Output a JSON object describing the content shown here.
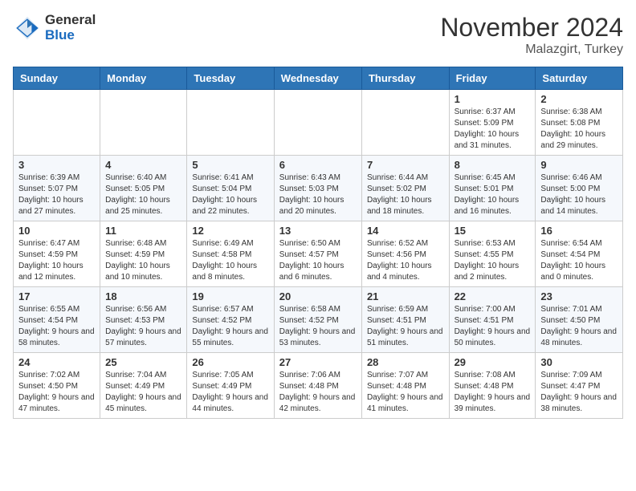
{
  "header": {
    "logo_general": "General",
    "logo_blue": "Blue",
    "month_title": "November 2024",
    "location": "Malazgirt, Turkey"
  },
  "days_of_week": [
    "Sunday",
    "Monday",
    "Tuesday",
    "Wednesday",
    "Thursday",
    "Friday",
    "Saturday"
  ],
  "weeks": [
    [
      {
        "day": "",
        "info": ""
      },
      {
        "day": "",
        "info": ""
      },
      {
        "day": "",
        "info": ""
      },
      {
        "day": "",
        "info": ""
      },
      {
        "day": "",
        "info": ""
      },
      {
        "day": "1",
        "info": "Sunrise: 6:37 AM\nSunset: 5:09 PM\nDaylight: 10 hours and 31 minutes."
      },
      {
        "day": "2",
        "info": "Sunrise: 6:38 AM\nSunset: 5:08 PM\nDaylight: 10 hours and 29 minutes."
      }
    ],
    [
      {
        "day": "3",
        "info": "Sunrise: 6:39 AM\nSunset: 5:07 PM\nDaylight: 10 hours and 27 minutes."
      },
      {
        "day": "4",
        "info": "Sunrise: 6:40 AM\nSunset: 5:05 PM\nDaylight: 10 hours and 25 minutes."
      },
      {
        "day": "5",
        "info": "Sunrise: 6:41 AM\nSunset: 5:04 PM\nDaylight: 10 hours and 22 minutes."
      },
      {
        "day": "6",
        "info": "Sunrise: 6:43 AM\nSunset: 5:03 PM\nDaylight: 10 hours and 20 minutes."
      },
      {
        "day": "7",
        "info": "Sunrise: 6:44 AM\nSunset: 5:02 PM\nDaylight: 10 hours and 18 minutes."
      },
      {
        "day": "8",
        "info": "Sunrise: 6:45 AM\nSunset: 5:01 PM\nDaylight: 10 hours and 16 minutes."
      },
      {
        "day": "9",
        "info": "Sunrise: 6:46 AM\nSunset: 5:00 PM\nDaylight: 10 hours and 14 minutes."
      }
    ],
    [
      {
        "day": "10",
        "info": "Sunrise: 6:47 AM\nSunset: 4:59 PM\nDaylight: 10 hours and 12 minutes."
      },
      {
        "day": "11",
        "info": "Sunrise: 6:48 AM\nSunset: 4:59 PM\nDaylight: 10 hours and 10 minutes."
      },
      {
        "day": "12",
        "info": "Sunrise: 6:49 AM\nSunset: 4:58 PM\nDaylight: 10 hours and 8 minutes."
      },
      {
        "day": "13",
        "info": "Sunrise: 6:50 AM\nSunset: 4:57 PM\nDaylight: 10 hours and 6 minutes."
      },
      {
        "day": "14",
        "info": "Sunrise: 6:52 AM\nSunset: 4:56 PM\nDaylight: 10 hours and 4 minutes."
      },
      {
        "day": "15",
        "info": "Sunrise: 6:53 AM\nSunset: 4:55 PM\nDaylight: 10 hours and 2 minutes."
      },
      {
        "day": "16",
        "info": "Sunrise: 6:54 AM\nSunset: 4:54 PM\nDaylight: 10 hours and 0 minutes."
      }
    ],
    [
      {
        "day": "17",
        "info": "Sunrise: 6:55 AM\nSunset: 4:54 PM\nDaylight: 9 hours and 58 minutes."
      },
      {
        "day": "18",
        "info": "Sunrise: 6:56 AM\nSunset: 4:53 PM\nDaylight: 9 hours and 57 minutes."
      },
      {
        "day": "19",
        "info": "Sunrise: 6:57 AM\nSunset: 4:52 PM\nDaylight: 9 hours and 55 minutes."
      },
      {
        "day": "20",
        "info": "Sunrise: 6:58 AM\nSunset: 4:52 PM\nDaylight: 9 hours and 53 minutes."
      },
      {
        "day": "21",
        "info": "Sunrise: 6:59 AM\nSunset: 4:51 PM\nDaylight: 9 hours and 51 minutes."
      },
      {
        "day": "22",
        "info": "Sunrise: 7:00 AM\nSunset: 4:51 PM\nDaylight: 9 hours and 50 minutes."
      },
      {
        "day": "23",
        "info": "Sunrise: 7:01 AM\nSunset: 4:50 PM\nDaylight: 9 hours and 48 minutes."
      }
    ],
    [
      {
        "day": "24",
        "info": "Sunrise: 7:02 AM\nSunset: 4:50 PM\nDaylight: 9 hours and 47 minutes."
      },
      {
        "day": "25",
        "info": "Sunrise: 7:04 AM\nSunset: 4:49 PM\nDaylight: 9 hours and 45 minutes."
      },
      {
        "day": "26",
        "info": "Sunrise: 7:05 AM\nSunset: 4:49 PM\nDaylight: 9 hours and 44 minutes."
      },
      {
        "day": "27",
        "info": "Sunrise: 7:06 AM\nSunset: 4:48 PM\nDaylight: 9 hours and 42 minutes."
      },
      {
        "day": "28",
        "info": "Sunrise: 7:07 AM\nSunset: 4:48 PM\nDaylight: 9 hours and 41 minutes."
      },
      {
        "day": "29",
        "info": "Sunrise: 7:08 AM\nSunset: 4:48 PM\nDaylight: 9 hours and 39 minutes."
      },
      {
        "day": "30",
        "info": "Sunrise: 7:09 AM\nSunset: 4:47 PM\nDaylight: 9 hours and 38 minutes."
      }
    ]
  ]
}
